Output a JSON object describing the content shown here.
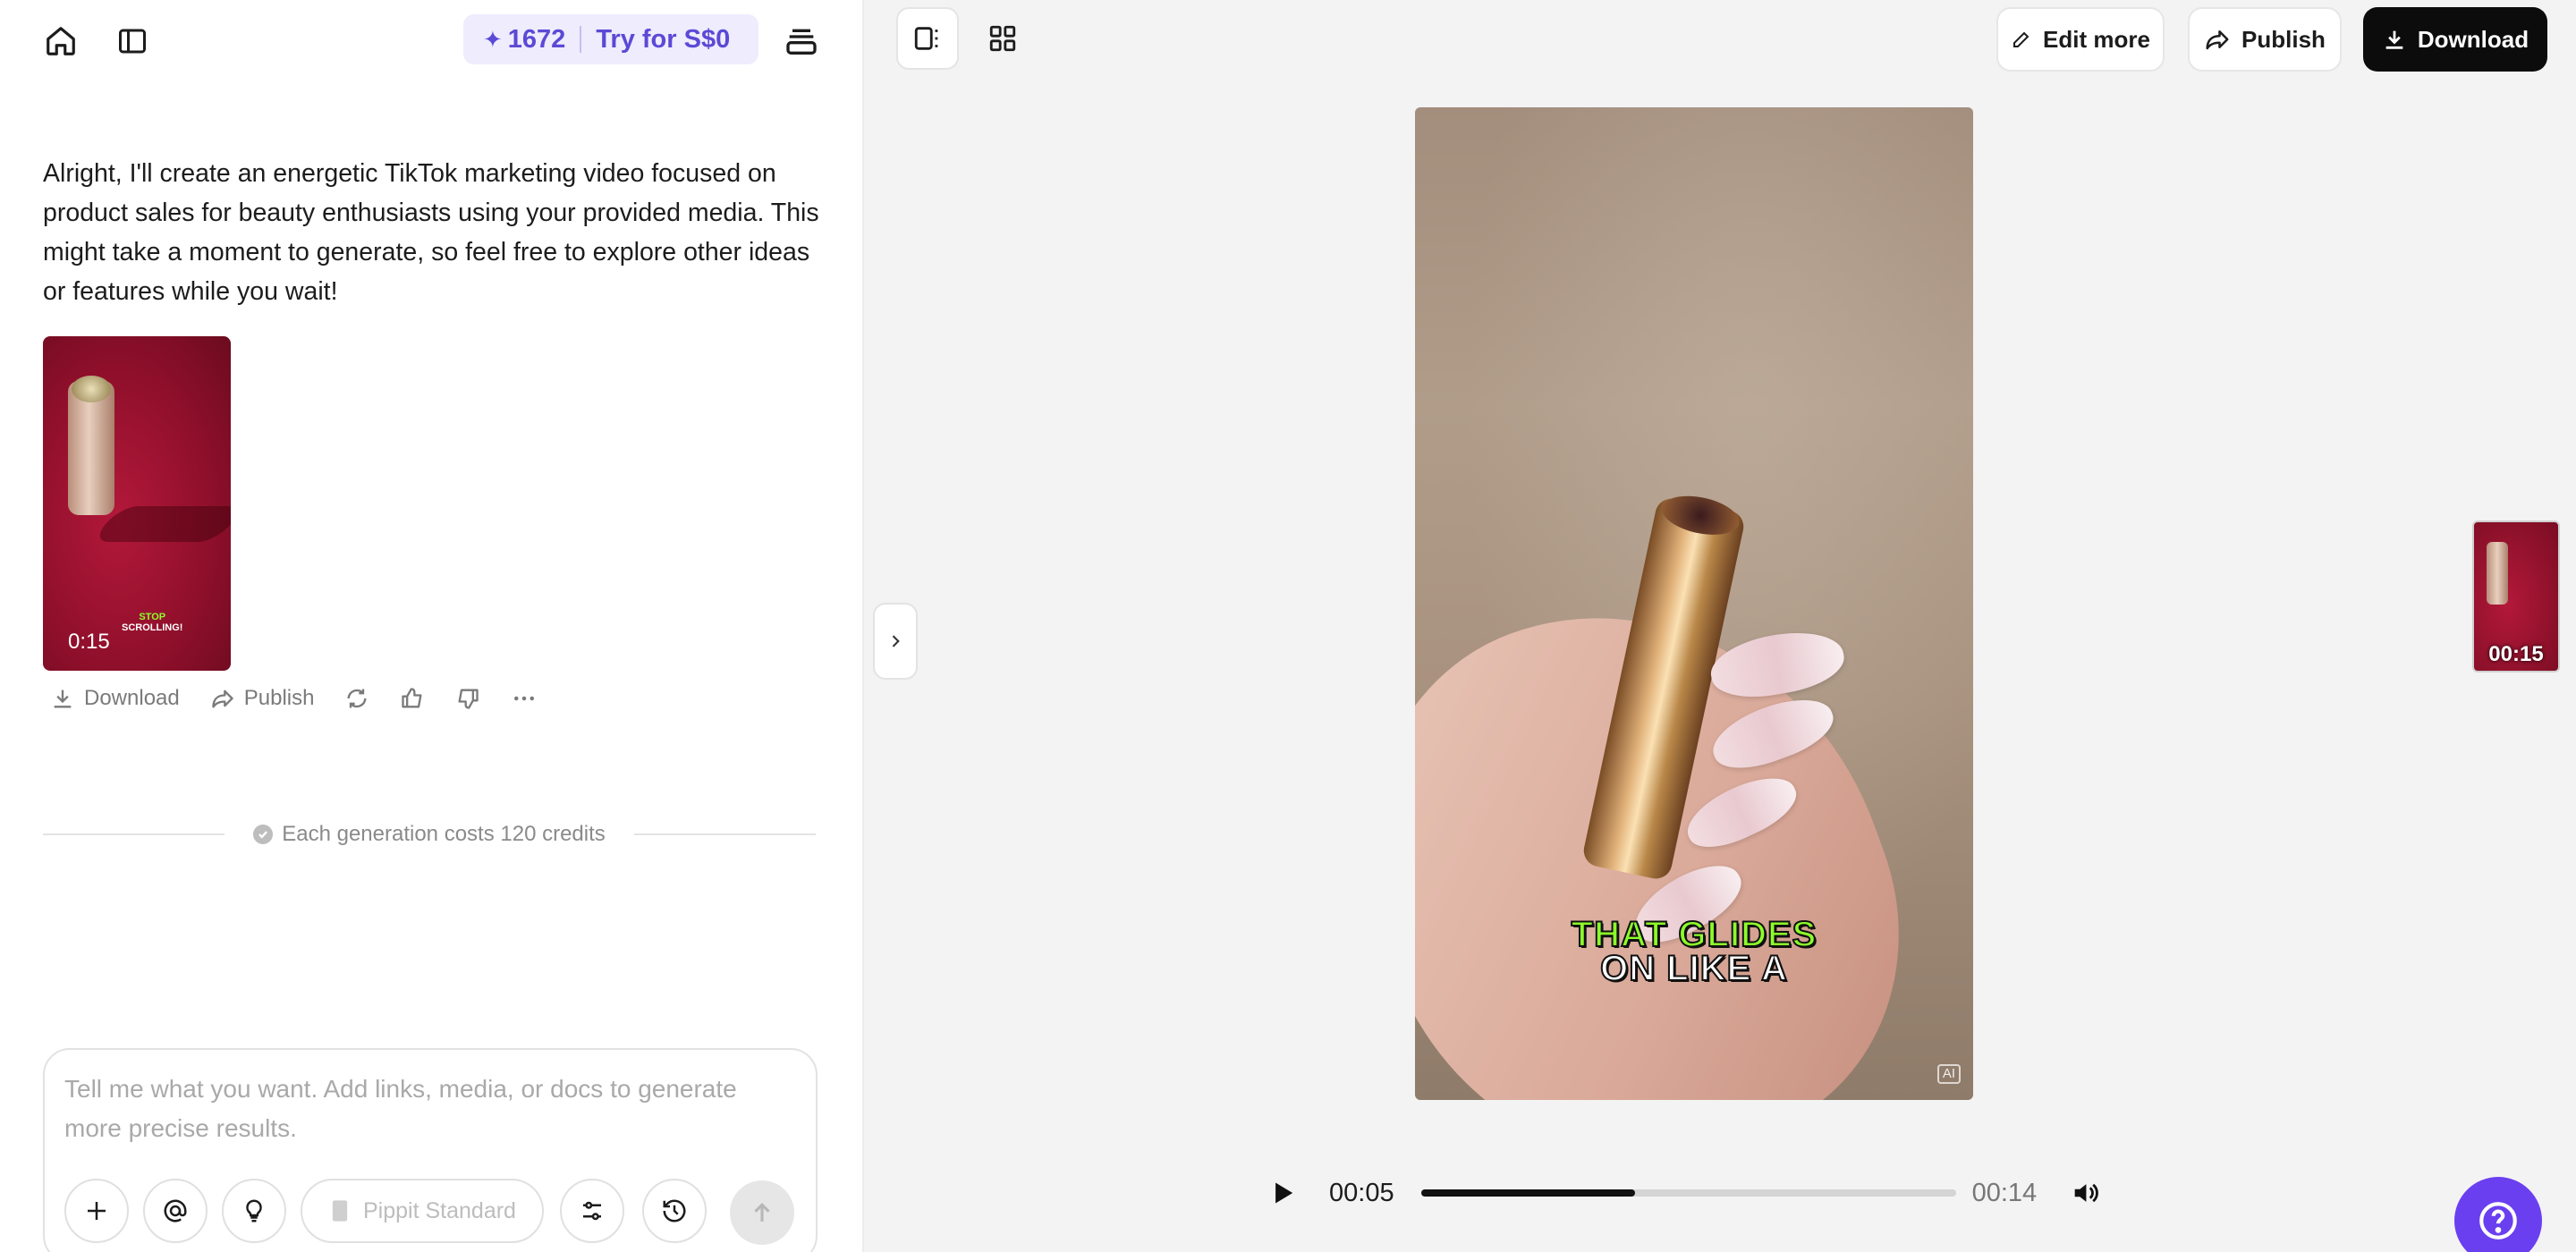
{
  "topbar": {
    "home_icon": "home-icon",
    "sidebar_icon": "sidebar-toggle-icon",
    "credits": "1672",
    "trial_label": "Try for S$0",
    "stack_icon": "stack-icon"
  },
  "chat": {
    "assistant_message": "Alright, I'll create an energetic TikTok marketing video focused on product sales for beauty enthusiasts using your provided media. This might take a moment to generate, so feel free to explore other ideas or features while you wait!",
    "thumbnail": {
      "duration": "0:15",
      "caption_line1": "STOP",
      "caption_line2": "SCROLLING!"
    },
    "actions": {
      "download_label": "Download",
      "publish_label": "Publish"
    },
    "cost_note": "Each generation costs 120 credits"
  },
  "composer": {
    "placeholder": "Tell me what you want. Add links, media, or docs to generate more precise results.",
    "model_label": "Pippit Standard"
  },
  "toolbar": {
    "edit_more_label": "Edit more",
    "publish_label": "Publish",
    "download_label": "Download"
  },
  "video": {
    "caption_line1": "THAT GLIDES",
    "caption_line2": "ON LIKE A",
    "ai_badge": "AI"
  },
  "player": {
    "current_time": "00:05",
    "duration": "00:14",
    "progress": 0.4
  },
  "side_thumbnail": {
    "duration": "00:15"
  },
  "colors": {
    "accent": "#5b49d6",
    "help_button": "#6a3ff0",
    "caption_highlight": "#8cff2a"
  }
}
